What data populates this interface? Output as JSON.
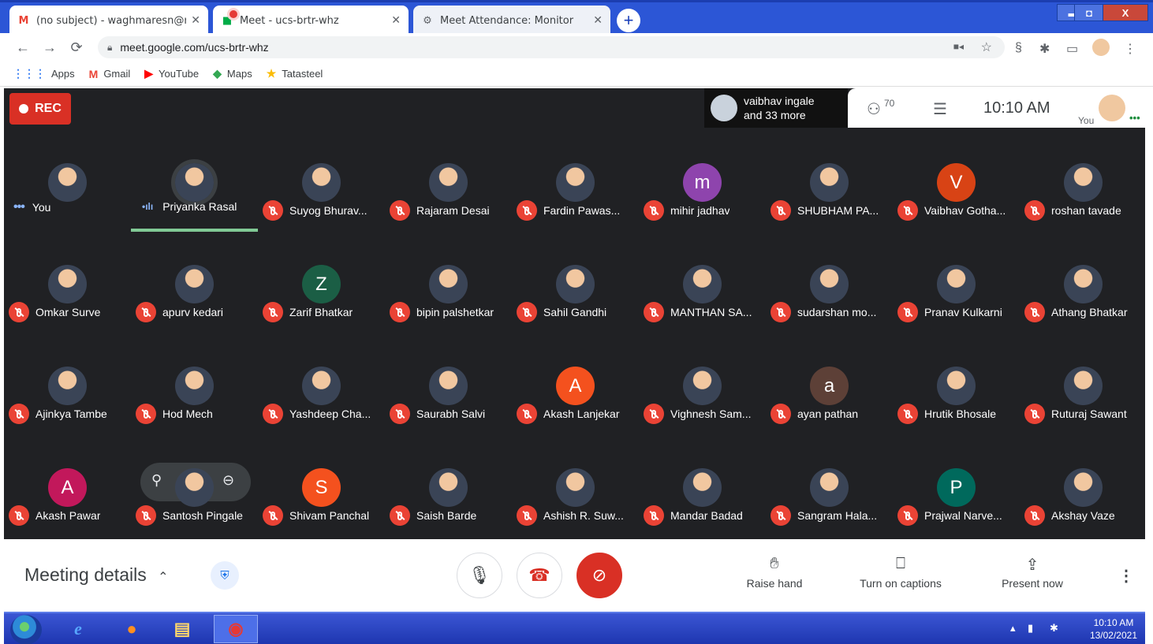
{
  "browser": {
    "tabs": [
      {
        "title": "(no subject) - waghmaresn@rmc",
        "favicon": "M"
      },
      {
        "title": "Meet - ucs-brtr-whz",
        "favicon": "■"
      },
      {
        "title": "Meet Attendance: Monitor",
        "favicon": "⚙"
      }
    ],
    "new_tab": "+",
    "window_controls": {
      "minimize": "▬",
      "maximize": "◘",
      "close": "X"
    },
    "url": "meet.google.com/ucs-brtr-whz",
    "bookmarks": [
      {
        "label": "Apps",
        "icon": "apps-grid-icon",
        "glyph": "⋮⋮⋮",
        "color": "#4285f4"
      },
      {
        "label": "Gmail",
        "icon": "gmail-icon",
        "glyph": "M",
        "color": "#ea4335"
      },
      {
        "label": "YouTube",
        "icon": "youtube-icon",
        "glyph": "▶",
        "color": "#ff0000"
      },
      {
        "label": "Maps",
        "icon": "maps-icon",
        "glyph": "◆",
        "color": "#34a853"
      },
      {
        "label": "Tatasteel",
        "icon": "star-icon",
        "glyph": "★",
        "color": "#fbbc04"
      }
    ]
  },
  "meet": {
    "rec_label": "REC",
    "presenter": {
      "name": "vaibhav ingale",
      "more": "and 33 more"
    },
    "participants_count": "70",
    "clock": "10:10 AM",
    "you_label": "You",
    "speaking_name": "Priyanka Rasal",
    "hover_name": "Santosh Pingale",
    "participants": [
      {
        "name": "You",
        "kind": "photo",
        "mic": "you"
      },
      {
        "name": "Priyanka Rasal",
        "kind": "photo",
        "mic": "speaking"
      },
      {
        "name": "Suyog Bhurav...",
        "kind": "photo",
        "mic": "off"
      },
      {
        "name": "Rajaram Desai",
        "kind": "photo",
        "mic": "off"
      },
      {
        "name": "Fardin Pawas...",
        "kind": "photo",
        "mic": "off"
      },
      {
        "name": "mihir jadhav",
        "kind": "letter",
        "letter": "m",
        "color": "#8e44ad",
        "mic": "off"
      },
      {
        "name": "SHUBHAM PA...",
        "kind": "photo",
        "mic": "off"
      },
      {
        "name": "Vaibhav Gotha...",
        "kind": "letter",
        "letter": "V",
        "color": "#d84315",
        "mic": "off"
      },
      {
        "name": "roshan tavade",
        "kind": "photo",
        "mic": "off"
      },
      {
        "name": "Omkar Surve",
        "kind": "photo",
        "mic": "off"
      },
      {
        "name": "apurv kedari",
        "kind": "photo",
        "mic": "off"
      },
      {
        "name": "Zarif Bhatkar",
        "kind": "letter",
        "letter": "Z",
        "color": "#1b5e45",
        "mic": "off"
      },
      {
        "name": "bipin palshetkar",
        "kind": "photo",
        "mic": "off"
      },
      {
        "name": "Sahil Gandhi",
        "kind": "photo",
        "mic": "off"
      },
      {
        "name": "MANTHAN SA...",
        "kind": "photo",
        "mic": "off"
      },
      {
        "name": "sudarshan mo...",
        "kind": "photo",
        "mic": "off"
      },
      {
        "name": "Pranav Kulkarni",
        "kind": "photo",
        "mic": "off"
      },
      {
        "name": "Athang Bhatkar",
        "kind": "photo",
        "mic": "off"
      },
      {
        "name": "Ajinkya Tambe",
        "kind": "photo",
        "mic": "off"
      },
      {
        "name": "Hod Mech",
        "kind": "photo",
        "mic": "off"
      },
      {
        "name": "Yashdeep Cha...",
        "kind": "photo",
        "mic": "off"
      },
      {
        "name": "Saurabh Salvi",
        "kind": "photo",
        "mic": "off"
      },
      {
        "name": "Akash Lanjekar",
        "kind": "letter",
        "letter": "A",
        "color": "#f4511e",
        "mic": "off"
      },
      {
        "name": "Vighnesh Sam...",
        "kind": "photo",
        "mic": "off"
      },
      {
        "name": "ayan pathan",
        "kind": "letter",
        "letter": "a",
        "color": "#5d4037",
        "mic": "off"
      },
      {
        "name": "Hrutik Bhosale",
        "kind": "photo",
        "mic": "off"
      },
      {
        "name": "Ruturaj Sawant",
        "kind": "photo",
        "mic": "off"
      },
      {
        "name": "Akash Pawar",
        "kind": "letter",
        "letter": "A",
        "color": "#c2185b",
        "mic": "off"
      },
      {
        "name": "Santosh Pingale",
        "kind": "photo",
        "mic": "off"
      },
      {
        "name": "Shivam Panchal",
        "kind": "letter",
        "letter": "S",
        "color": "#f4511e",
        "mic": "off"
      },
      {
        "name": "Saish Barde",
        "kind": "photo",
        "mic": "off"
      },
      {
        "name": "Ashish R. Suw...",
        "kind": "photo",
        "mic": "off"
      },
      {
        "name": "Mandar Badad",
        "kind": "photo",
        "mic": "off"
      },
      {
        "name": "Sangram Hala...",
        "kind": "photo",
        "mic": "off"
      },
      {
        "name": "Prajwal Narve...",
        "kind": "letter",
        "letter": "P",
        "color": "#00695c",
        "mic": "off"
      },
      {
        "name": "Akshay Vaze",
        "kind": "photo",
        "mic": "off"
      }
    ]
  },
  "bottom": {
    "meeting_details": "Meeting details",
    "raise_hand": "Raise hand",
    "captions": "Turn on captions",
    "present": "Present now"
  },
  "taskbar": {
    "time": "10:10 AM",
    "date": "13/02/2021"
  },
  "colors": {
    "rec_red": "#d93025",
    "meet_bg": "#202124",
    "mic_off": "#ea4335",
    "speaking_line": "#81c995",
    "taskbar": "#2c56d6"
  }
}
